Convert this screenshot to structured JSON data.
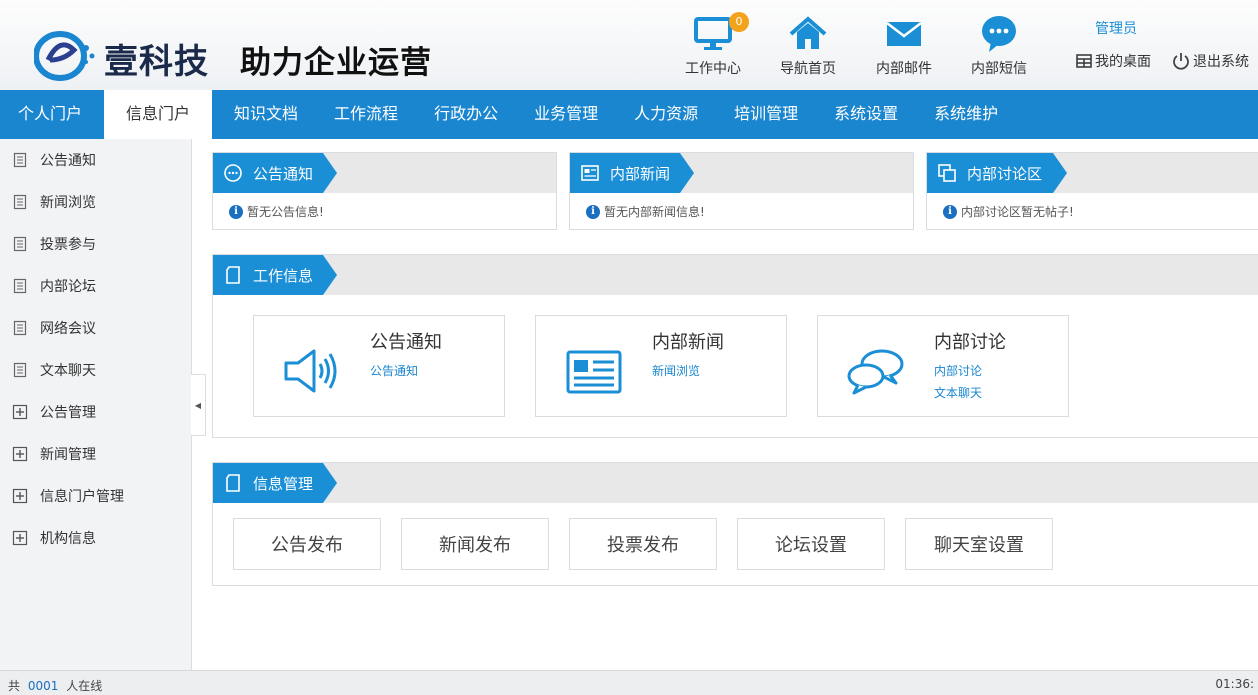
{
  "header": {
    "brand": "壹科技",
    "slogan": "助力企业运营",
    "nav": [
      {
        "label": "工作中心",
        "icon": "monitor-icon",
        "badge": "0"
      },
      {
        "label": "导航首页",
        "icon": "home-icon"
      },
      {
        "label": "内部邮件",
        "icon": "mail-icon"
      },
      {
        "label": "内部短信",
        "icon": "chat-bubble-icon"
      }
    ],
    "user": "管理员",
    "desktop": "我的桌面",
    "logout": "退出系统"
  },
  "mainnav": [
    "个人门户",
    "信息门户",
    "知识文档",
    "工作流程",
    "行政办公",
    "业务管理",
    "人力资源",
    "培训管理",
    "系统设置",
    "系统维护"
  ],
  "mainnav_active": "信息门户",
  "sidebar": [
    {
      "label": "公告通知",
      "icon": "document-icon"
    },
    {
      "label": "新闻浏览",
      "icon": "document-icon"
    },
    {
      "label": "投票参与",
      "icon": "document-icon"
    },
    {
      "label": "内部论坛",
      "icon": "document-icon"
    },
    {
      "label": "网络会议",
      "icon": "document-icon"
    },
    {
      "label": "文本聊天",
      "icon": "document-icon"
    },
    {
      "label": "公告管理",
      "icon": "expand-plus-icon"
    },
    {
      "label": "新闻管理",
      "icon": "expand-plus-icon"
    },
    {
      "label": "信息门户管理",
      "icon": "expand-plus-icon"
    },
    {
      "label": "机构信息",
      "icon": "expand-plus-icon"
    }
  ],
  "panels": {
    "notice": {
      "title": "公告通知",
      "msg": "暂无公告信息!"
    },
    "news": {
      "title": "内部新闻",
      "msg": "暂无内部新闻信息!"
    },
    "forum": {
      "title": "内部讨论区",
      "msg": "内部讨论区暂无帖子!"
    }
  },
  "work": {
    "title": "工作信息",
    "cards": [
      {
        "title": "公告通知",
        "links": [
          "公告通知"
        ],
        "icon": "speaker-icon"
      },
      {
        "title": "内部新闻",
        "links": [
          "新闻浏览"
        ],
        "icon": "newspaper-icon"
      },
      {
        "title": "内部讨论",
        "links": [
          "内部讨论",
          "文本聊天"
        ],
        "icon": "speech-bubbles-icon"
      }
    ]
  },
  "manage": {
    "title": "信息管理",
    "buttons": [
      "公告发布",
      "新闻发布",
      "投票发布",
      "论坛设置",
      "聊天室设置"
    ]
  },
  "footer": {
    "prefix": "共",
    "count": "0001",
    "suffix": "人在线",
    "time": "01:36:"
  },
  "colors": {
    "primary": "#1a86d0",
    "badge": "#f5a21b"
  }
}
